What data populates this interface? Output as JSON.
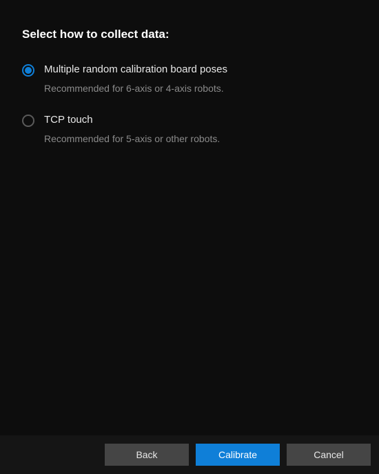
{
  "title": "Select how to collect data:",
  "options": [
    {
      "label": "Multiple random calibration board poses",
      "description": "Recommended for 6-axis or 4-axis robots.",
      "selected": true
    },
    {
      "label": "TCP touch",
      "description": "Recommended for 5-axis or other robots.",
      "selected": false
    }
  ],
  "footer": {
    "back_label": "Back",
    "calibrate_label": "Calibrate",
    "cancel_label": "Cancel"
  }
}
